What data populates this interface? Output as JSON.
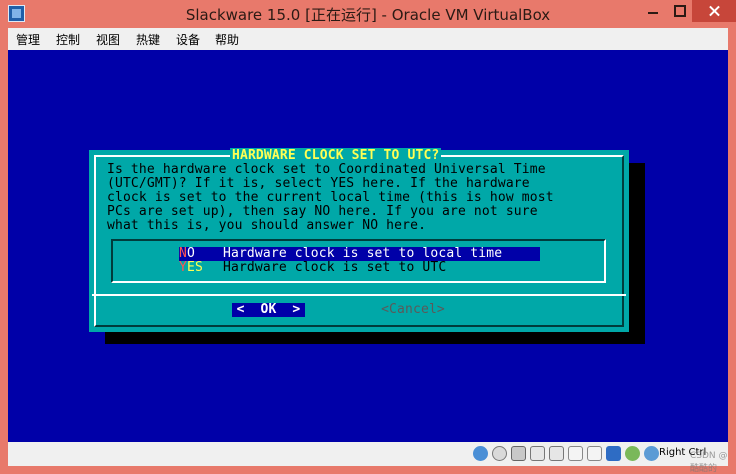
{
  "window": {
    "title": "Slackware 15.0 [正在运行] - Oracle VM VirtualBox"
  },
  "menu": [
    "管理",
    "控制",
    "视图",
    "热键",
    "设备",
    "帮助"
  ],
  "dialog": {
    "title": "HARDWARE CLOCK SET TO UTC?",
    "body_lines": [
      "Is the hardware clock set to Coordinated Universal Time",
      "(UTC/GMT)? If it is, select YES here. If the hardware",
      "clock is set to the current local time (this is how most",
      "PCs are set up), then say NO here. If you are not sure",
      "what this is, you should answer NO here."
    ],
    "items": [
      {
        "tag_hot": "N",
        "tag_rest": "O",
        "desc": "Hardware clock is set to local time",
        "selected": true
      },
      {
        "tag_hot": "Y",
        "tag_rest": "ES",
        "desc": "Hardware clock is set to UTC",
        "selected": false
      }
    ],
    "ok_label": "<  OK  >",
    "cancel_label": "<Cancel>"
  },
  "statusbar": {
    "host_key": "Right Ctrl",
    "watermark": "CSDN @酷酷的"
  },
  "colors": {
    "dialog_bg": "#00a8a8",
    "screen_bg": "#0000a8",
    "title_text": "#ffff54",
    "hotkey": "#ff5454"
  }
}
